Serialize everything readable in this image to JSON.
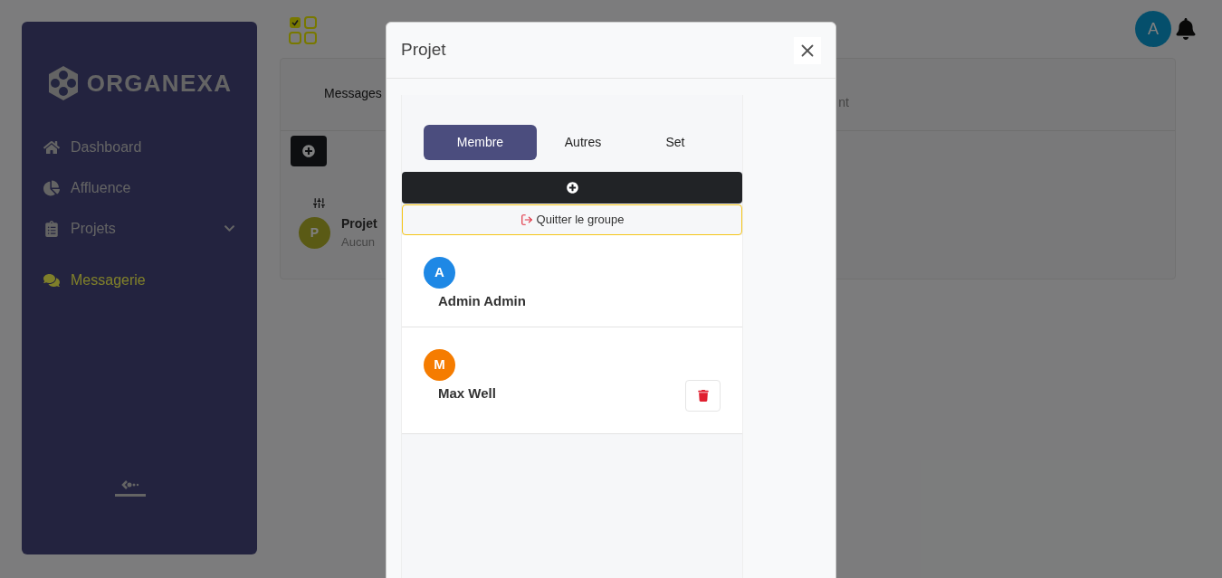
{
  "sidebar": {
    "logo": "ORGANEXA",
    "items": [
      {
        "label": "Dashboard",
        "selected": false,
        "expandable": false
      },
      {
        "label": "Affluence",
        "selected": false,
        "expandable": false
      },
      {
        "label": "Projets",
        "selected": false,
        "expandable": true
      },
      {
        "label": "Messagerie",
        "selected": true,
        "expandable": false
      }
    ]
  },
  "header": {
    "avatar": "A"
  },
  "background_card": {
    "tabs": [
      "Messages",
      "nt"
    ],
    "conversation": {
      "avatar": "P",
      "title": "Projet",
      "subtitle": "Aucun"
    }
  },
  "modal": {
    "title": "Projet",
    "tabs": [
      {
        "label": "Membre",
        "selected": true
      },
      {
        "label": "Autres",
        "selected": false
      },
      {
        "label": "Set",
        "selected": false
      }
    ],
    "leave_button": "Quitter le groupe",
    "members": [
      {
        "initial": "A",
        "name": "Admin Admin",
        "color": "#1e88e5",
        "removable": false
      },
      {
        "initial": "M",
        "name": "Max Well",
        "color": "#f57c00",
        "removable": true
      }
    ]
  }
}
